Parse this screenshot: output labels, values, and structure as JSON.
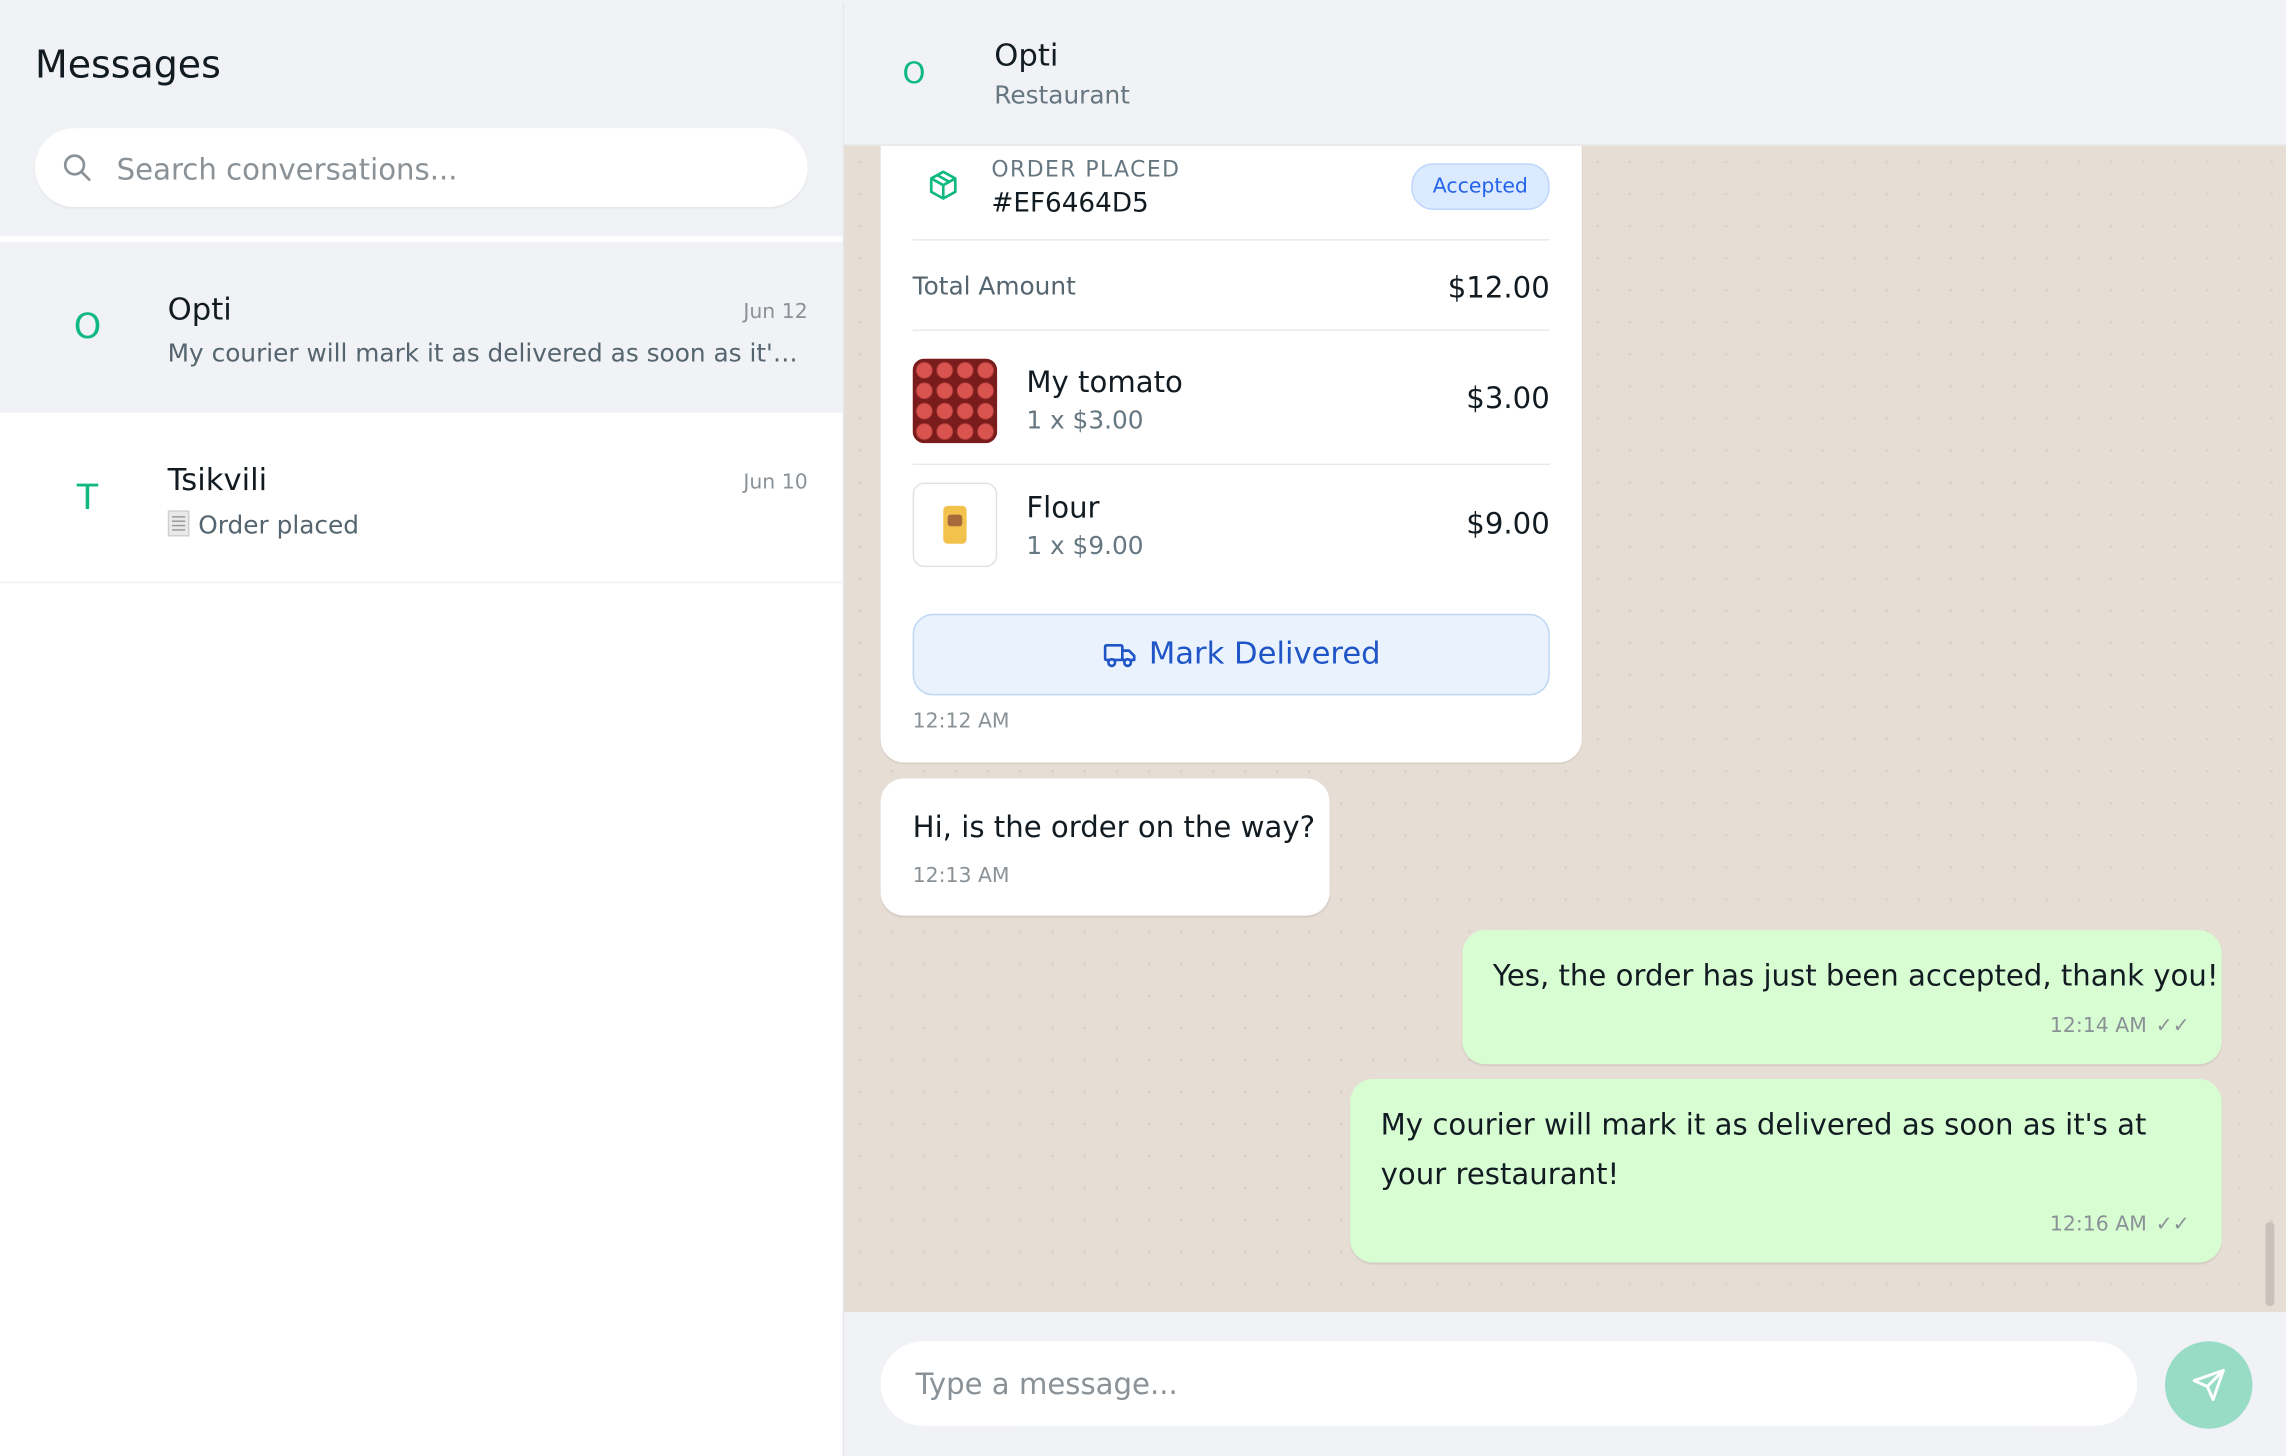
{
  "colors": {
    "accent": "#10b981",
    "outgoing_bubble": "#d9fdd3",
    "badge_text": "#2563eb",
    "badge_bg": "#dbeafe",
    "send_button": "#99dcc6"
  },
  "sidebar": {
    "title": "Messages",
    "search": {
      "placeholder": "Search conversations..."
    },
    "conversations": [
      {
        "initial": "O",
        "name": "Opti",
        "date": "Jun 12",
        "preview": "My courier will mark it as delivered as soon as it's at your restaurant!",
        "active": true
      },
      {
        "initial": "T",
        "name": "Tsikvili",
        "date": "Jun 10",
        "preview": "Order placed",
        "preview_icon": "receipt-icon",
        "active": false
      }
    ]
  },
  "chat": {
    "header": {
      "initial": "O",
      "name": "Opti",
      "subtitle": "Restaurant"
    },
    "order": {
      "label": "ORDER PLACED",
      "id": "#EF6464D5",
      "status": "Accepted",
      "total_label": "Total Amount",
      "total_value": "$12.00",
      "items": [
        {
          "name": "My tomato",
          "qty": "1 x $3.00",
          "price": "$3.00",
          "thumb": "tomato"
        },
        {
          "name": "Flour",
          "qty": "1 x $9.00",
          "price": "$9.00",
          "thumb": "flour"
        }
      ],
      "action_label": "Mark Delivered",
      "time": "12:12 AM"
    },
    "messages": [
      {
        "direction": "in",
        "text": "Hi, is the order on the way?",
        "time": "12:13 AM"
      },
      {
        "direction": "out",
        "text": "Yes, the order has just been accepted, thank you!",
        "time": "12:14 AM",
        "ticks": "✓✓"
      },
      {
        "direction": "out",
        "text": "My courier will mark it as delivered as soon as it's at your restaurant!",
        "time": "12:16 AM",
        "ticks": "✓✓"
      }
    ],
    "composer": {
      "placeholder": "Type a message..."
    }
  }
}
